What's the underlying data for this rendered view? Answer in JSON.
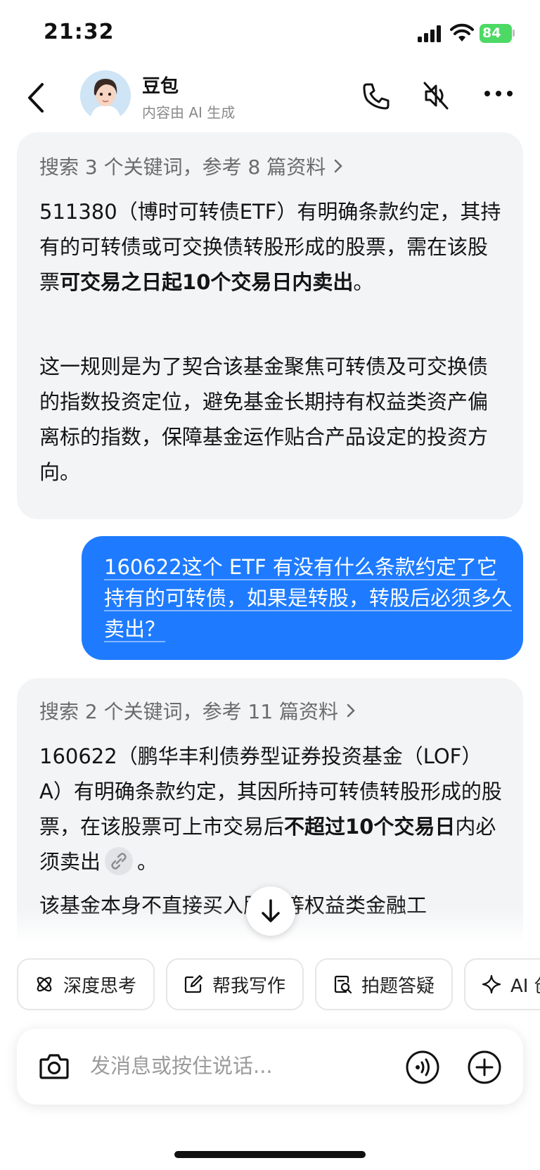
{
  "status_bar": {
    "time": "21:32",
    "battery": "84"
  },
  "header": {
    "name": "豆包",
    "subtitle": "内容由 AI 生成"
  },
  "messages": [
    {
      "role": "bot",
      "search_summary": "搜索 3 个关键词，参考 8 篇资料",
      "p1_a": "511380（博时可转债ETF）有明确条款约定，其持有的可转债或可交换债转股形成的股票，需在该股票",
      "p1_b": "可交易之日起10个交易日内卖出",
      "p1_c": "。",
      "p2": "这一规则是为了契合该基金聚焦可转债及可交换债的指数投资定位，避免基金长期持有权益类资产偏离标的指数，保障基金运作贴合产品设定的投资方向。"
    },
    {
      "role": "user",
      "text": "160622这个 ETF 有没有什么条款约定了它持有的可转债，如果是转股，转股后必须多久卖出？"
    },
    {
      "role": "bot",
      "search_summary": "搜索 2 个关键词，参考 11 篇资料",
      "p1_a": "160622（鹏华丰利债券型证券投资基金（LOF）A）有明确条款约定，其因所持可转债转股形成的股票，在该股票可上市交易后",
      "p1_b": "不超过10个交易日",
      "p1_c": "内必须卖出",
      "p1_d": "。",
      "p2": "该基金本身不直接买入股票等权益类金融工"
    }
  ],
  "chips": [
    "深度思考",
    "帮我写作",
    "拍题答疑",
    "AI 创"
  ],
  "input": {
    "placeholder": "发消息或按住说话..."
  }
}
